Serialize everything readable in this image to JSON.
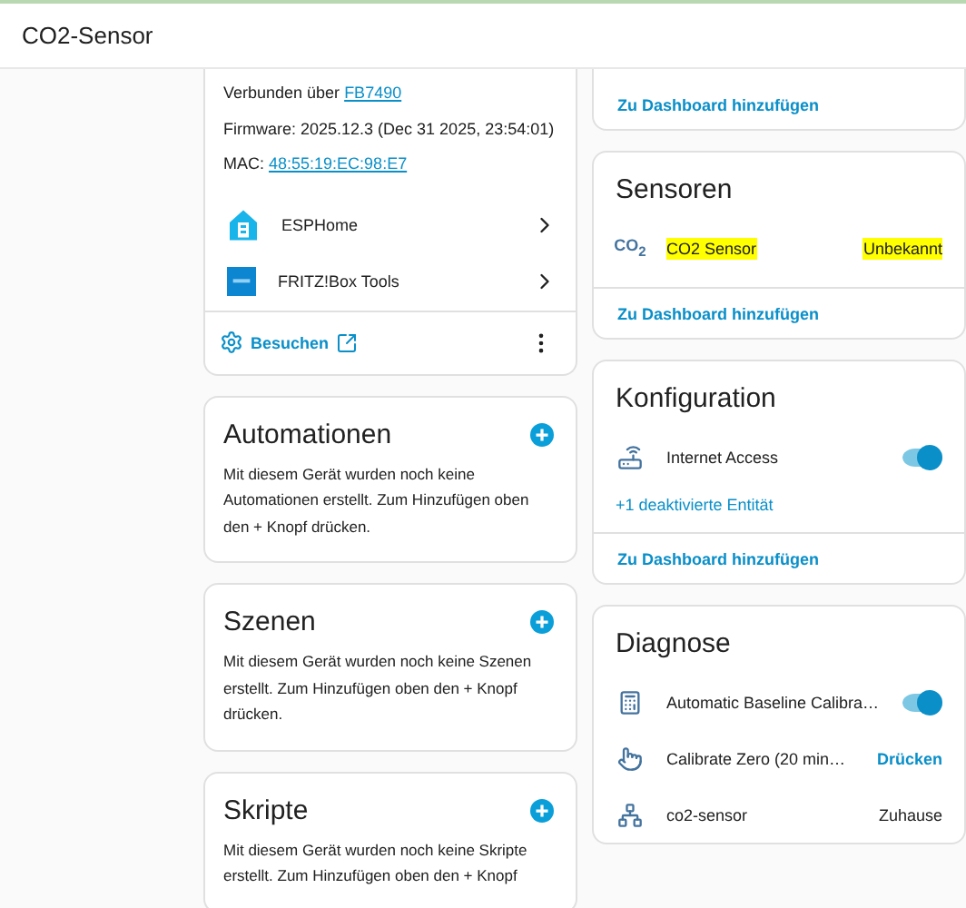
{
  "header": {
    "title": "CO2-Sensor"
  },
  "device_info": {
    "lines": [
      {
        "label": "Verbunden über ",
        "link": "FB7490"
      },
      {
        "label": "Firmware: 2025.12.3 (Dec 31 2025, 23:54:01)"
      },
      {
        "label": "MAC: ",
        "link": "48:55:19:EC:98:E7"
      }
    ],
    "integrations": [
      {
        "kind": "esphome",
        "name": "ESPHome"
      },
      {
        "kind": "fritzbox",
        "name": "FRITZ!Box Tools"
      }
    ],
    "visit": "Besuchen"
  },
  "left_cards": [
    {
      "title": "Automationen",
      "text": "Mit diesem Gerät wurden noch keine Automationen erstellt. Zum Hinzufügen oben den + Knopf drücken."
    },
    {
      "title": "Szenen",
      "text": "Mit diesem Gerät wurden noch keine Szenen erstellt. Zum Hinzufügen oben den + Knopf drücken."
    },
    {
      "title": "Skripte",
      "text": "Mit diesem Gerät wurden noch keine Skripte erstellt. Zum Hinzufügen oben den + Knopf"
    }
  ],
  "top_card": {
    "link": "Zu Dashboard hinzufügen"
  },
  "entity_cards": [
    {
      "title": "Sensoren",
      "rows": [
        {
          "kind": "state",
          "icon_text": "CO$_{2}$",
          "name": "CO2 Sensor",
          "value": "Unbekannt",
          "highlighted": true
        }
      ],
      "link": "Zu Dashboard hinzufügen"
    },
    {
      "title": "Konfiguration",
      "rows": [
        {
          "kind": "toggle",
          "name": "Internet Access",
          "on": true
        }
      ],
      "extra": "+1 deaktivierte Entität",
      "link": "Zu Dashboard hinzufügen"
    },
    {
      "title": "Diagnose",
      "rows": [
        {
          "kind": "toggle",
          "name": "Automatic Baseline Calibra…",
          "on": true
        },
        {
          "kind": "button",
          "name": "Calibrate Zero (20 min…",
          "value": "Drücken"
        },
        {
          "kind": "state",
          "name": "co2-sensor",
          "value": "Zuhause",
          "highlighted": false
        }
      ]
    }
  ]
}
